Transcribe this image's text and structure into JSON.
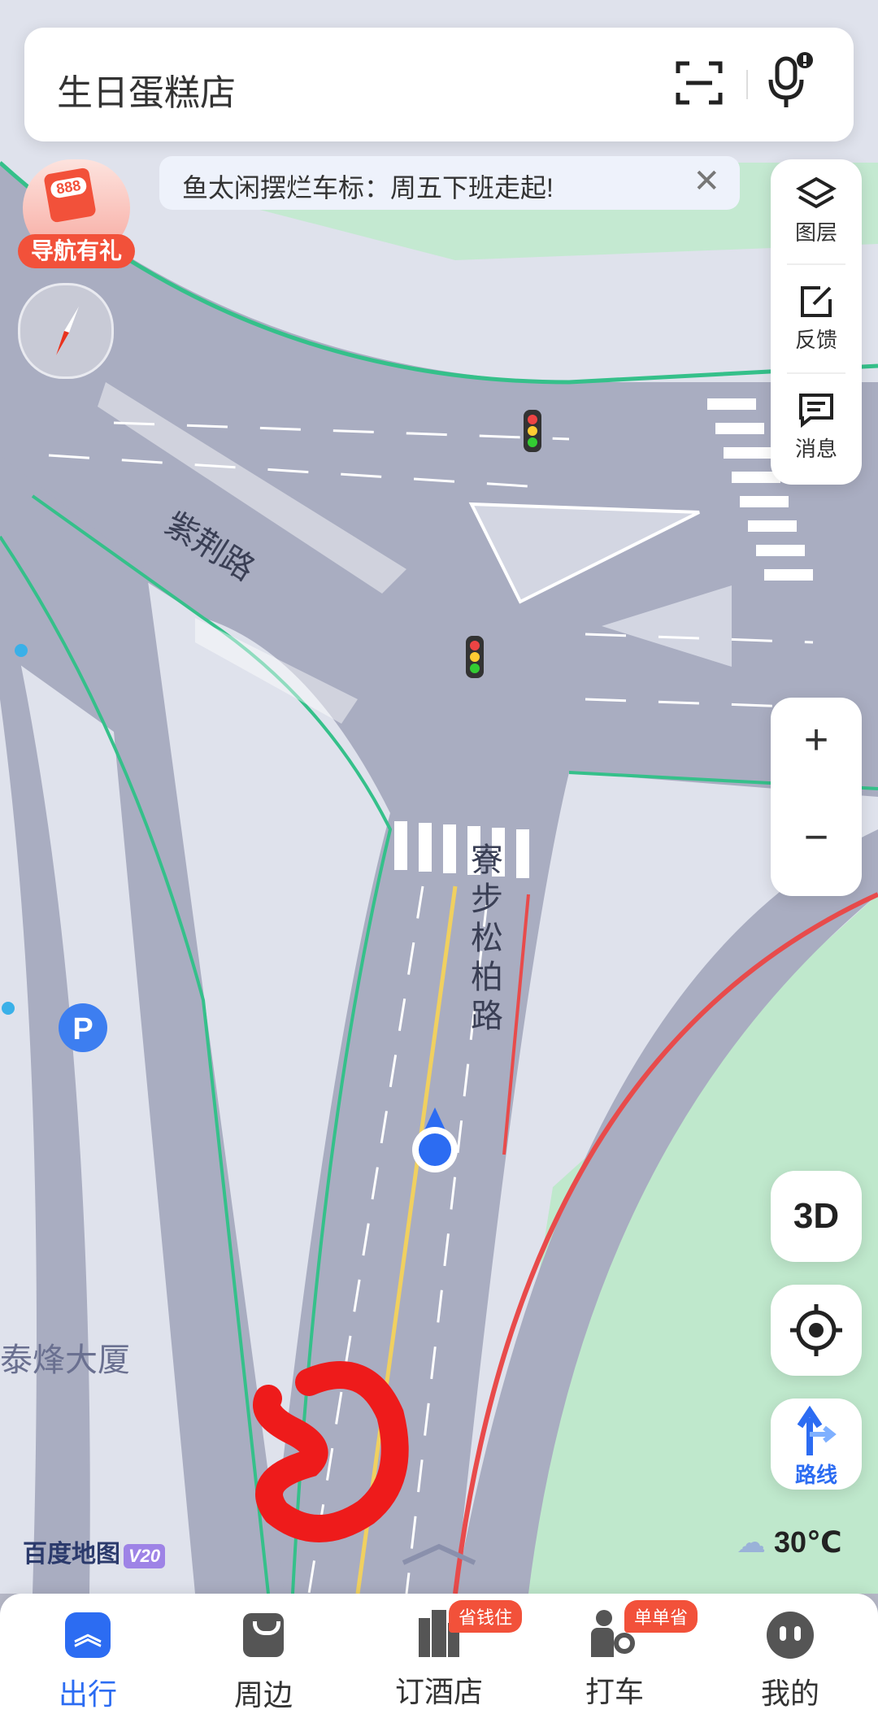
{
  "search": {
    "query": "生日蛋糕店"
  },
  "banner": {
    "text": "鱼太闲摆烂车标：周五下班走起!",
    "close": "✕"
  },
  "promo": {
    "badge_text": "888",
    "label": "导航有礼"
  },
  "side_panel": {
    "layers": "图层",
    "feedback": "反馈",
    "messages": "消息"
  },
  "zoom": {
    "in": "+",
    "out": "−"
  },
  "map_labels": {
    "road1": "紫荆路",
    "road2_chars": [
      "寮",
      "步",
      "松",
      "柏",
      "路"
    ],
    "building": "泰烽大厦"
  },
  "controls": {
    "three_d": "3D",
    "route": "路线"
  },
  "weather": {
    "temp": "30℃"
  },
  "logo": {
    "name": "百度地图",
    "version": "V20"
  },
  "tabs": [
    {
      "label": "出行",
      "active": true,
      "badge": ""
    },
    {
      "label": "周边",
      "active": false,
      "badge": ""
    },
    {
      "label": "订酒店",
      "active": false,
      "badge": "省钱住"
    },
    {
      "label": "打车",
      "active": false,
      "badge": "单单省"
    },
    {
      "label": "我的",
      "active": false,
      "badge": ""
    }
  ],
  "colors": {
    "accent": "#2c6cf2",
    "road": "#a9adc1",
    "green_area": "#bfe8cc",
    "highlight_red": "#e84b4b"
  }
}
